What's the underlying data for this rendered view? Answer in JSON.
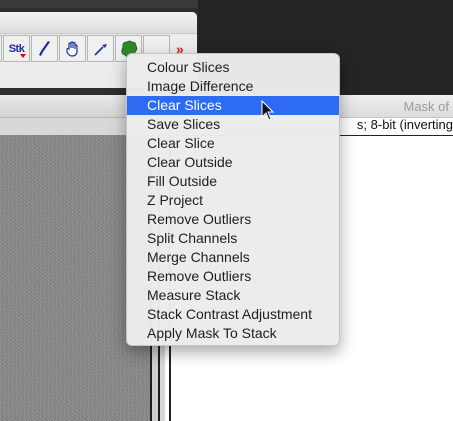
{
  "toolbar": {
    "stk_label": "Stk",
    "tools": [
      {
        "icon": "stk-menu-icon"
      },
      {
        "icon": "brush-icon"
      },
      {
        "icon": "hand-icon"
      },
      {
        "icon": "pipette-icon"
      },
      {
        "icon": "green-blob-icon",
        "color": "#2f8a2b"
      },
      {
        "icon": "blank-tool-icon"
      }
    ],
    "more_label": "»",
    "more_color": "#d4181e"
  },
  "mask_window": {
    "title": "Mask of",
    "info": "s; 8-bit (inverting"
  },
  "context_menu": {
    "selected_index": 2,
    "selected_color": "#2d6cf2",
    "items": [
      "Colour Slices",
      "Image Difference",
      "Clear Slices",
      "Save Slices",
      "Clear Slice",
      "Clear Outside",
      "Fill Outside",
      "Z Project",
      "Remove Outliers",
      "Split Channels",
      "Merge Channels",
      "Remove Outliers",
      "Measure Stack",
      "Stack Contrast Adjustment",
      "Apply Mask To Stack"
    ]
  }
}
